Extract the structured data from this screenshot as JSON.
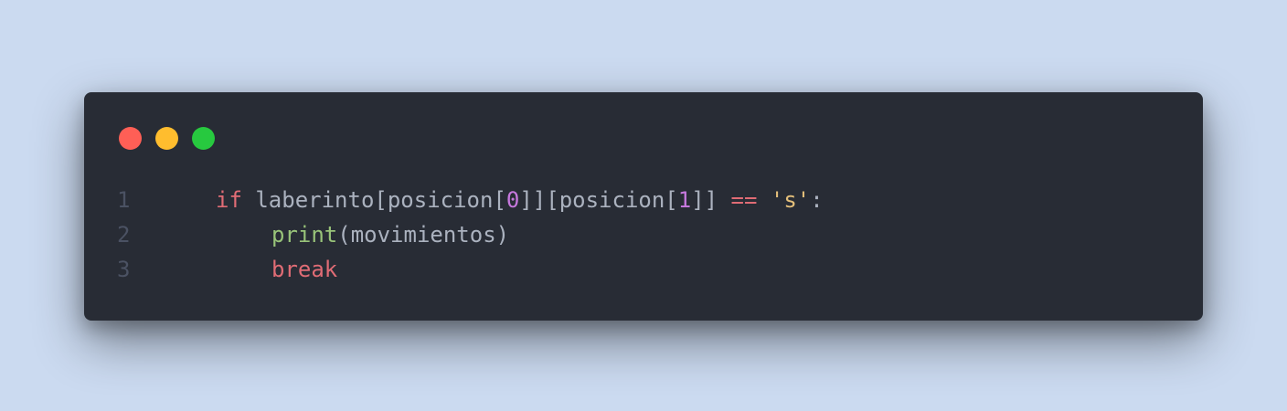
{
  "colors": {
    "background": "#cbdaf0",
    "window": "#282c35",
    "close_dot": "#ff5f56",
    "minimize_dot": "#ffbd2e",
    "maximize_dot": "#27c93f",
    "line_number": "#4b5263",
    "keyword": "#e06c75",
    "number": "#c678dd",
    "string": "#e5c07b",
    "function": "#98c379",
    "text": "#abb2bf"
  },
  "window_controls": [
    "close",
    "minimize",
    "maximize"
  ],
  "code": {
    "language": "python",
    "lines": [
      {
        "number": "1",
        "tokens": [
          {
            "text": "if",
            "kind": "kw"
          },
          {
            "text": " laberinto[posicion[",
            "kind": "plain"
          },
          {
            "text": "0",
            "kind": "num"
          },
          {
            "text": "]][posicion[",
            "kind": "plain"
          },
          {
            "text": "1",
            "kind": "num"
          },
          {
            "text": "]] ",
            "kind": "plain"
          },
          {
            "text": "==",
            "kind": "op"
          },
          {
            "text": " ",
            "kind": "plain"
          },
          {
            "text": "'s'",
            "kind": "str"
          },
          {
            "text": ":",
            "kind": "plain"
          }
        ]
      },
      {
        "number": "2",
        "tokens": [
          {
            "text": "print",
            "kind": "fn"
          },
          {
            "text": "(movimientos)",
            "kind": "plain"
          }
        ]
      },
      {
        "number": "3",
        "tokens": [
          {
            "text": "break",
            "kind": "kw"
          }
        ]
      }
    ]
  }
}
